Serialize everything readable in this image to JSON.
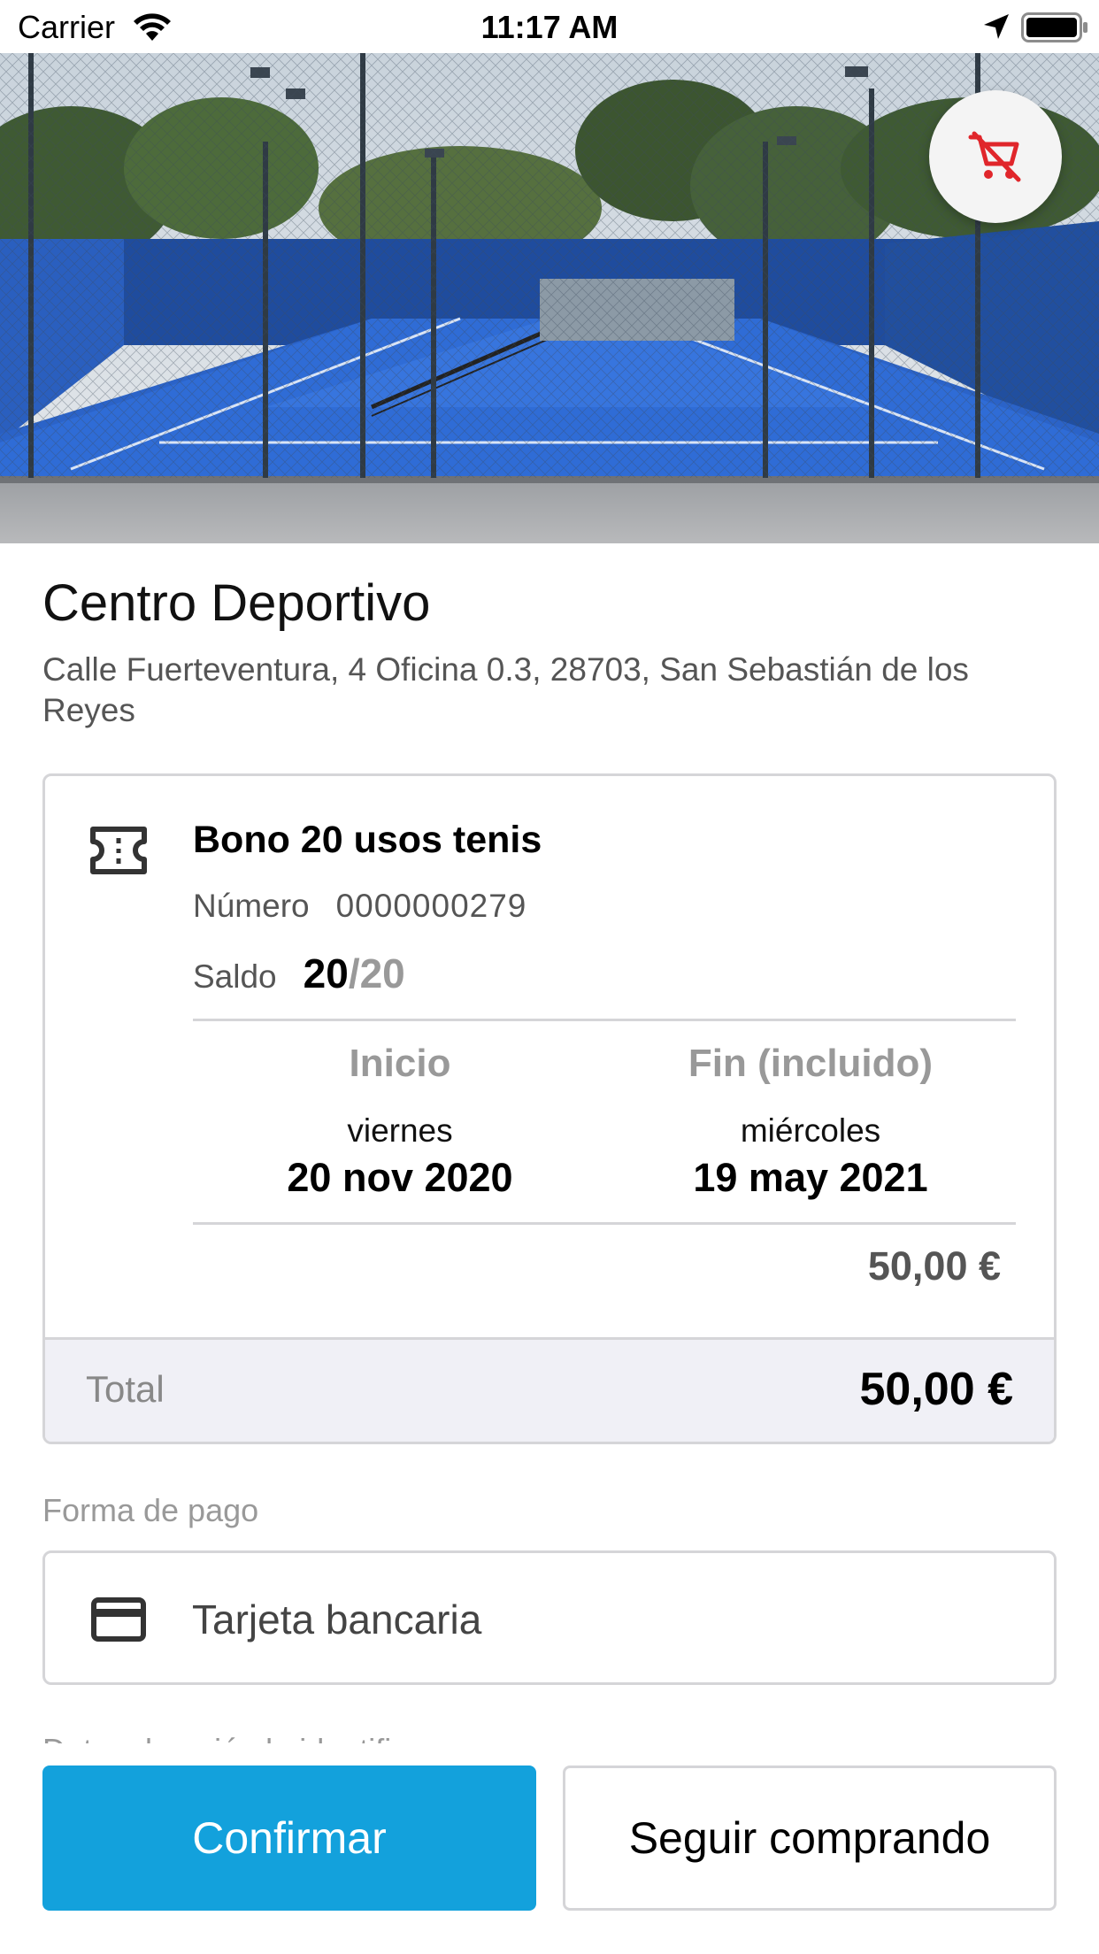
{
  "status_bar": {
    "carrier": "Carrier",
    "time": "11:17 AM"
  },
  "hero": {
    "image": "tennis-padel-courts-photo",
    "cart_icon": "remove-from-cart-icon",
    "cart_icon_color": "#e0262b"
  },
  "venue": {
    "name": "Centro Deportivo",
    "address": "Calle Fuerteventura, 4 Oficina 0.3, 28703, San Sebastián de los Reyes"
  },
  "ticket": {
    "icon": "ticket-icon",
    "title": "Bono 20 usos tenis",
    "number_label": "Número",
    "number_value": "0000000279",
    "balance_label": "Saldo",
    "balance_current": "20",
    "balance_separator": "/",
    "balance_total": "20",
    "start": {
      "label": "Inicio",
      "weekday": "viernes",
      "date": "20 nov 2020"
    },
    "end": {
      "label": "Fin (incluido)",
      "weekday": "miércoles",
      "date": "19 may 2021"
    },
    "price": "50,00 €"
  },
  "total": {
    "label": "Total",
    "value": "50,00 €"
  },
  "payment": {
    "label": "Forma de pago",
    "icon": "credit-card-icon",
    "method": "Tarjeta bancaria"
  },
  "next_section_partial": "Datos de quién lo identifica",
  "actions": {
    "confirm": "Confirmar",
    "continue_shopping": "Seguir comprando"
  },
  "colors": {
    "primary": "#13a1dc",
    "total_bar": "#f0f0f6",
    "border": "#d5d5d8"
  }
}
